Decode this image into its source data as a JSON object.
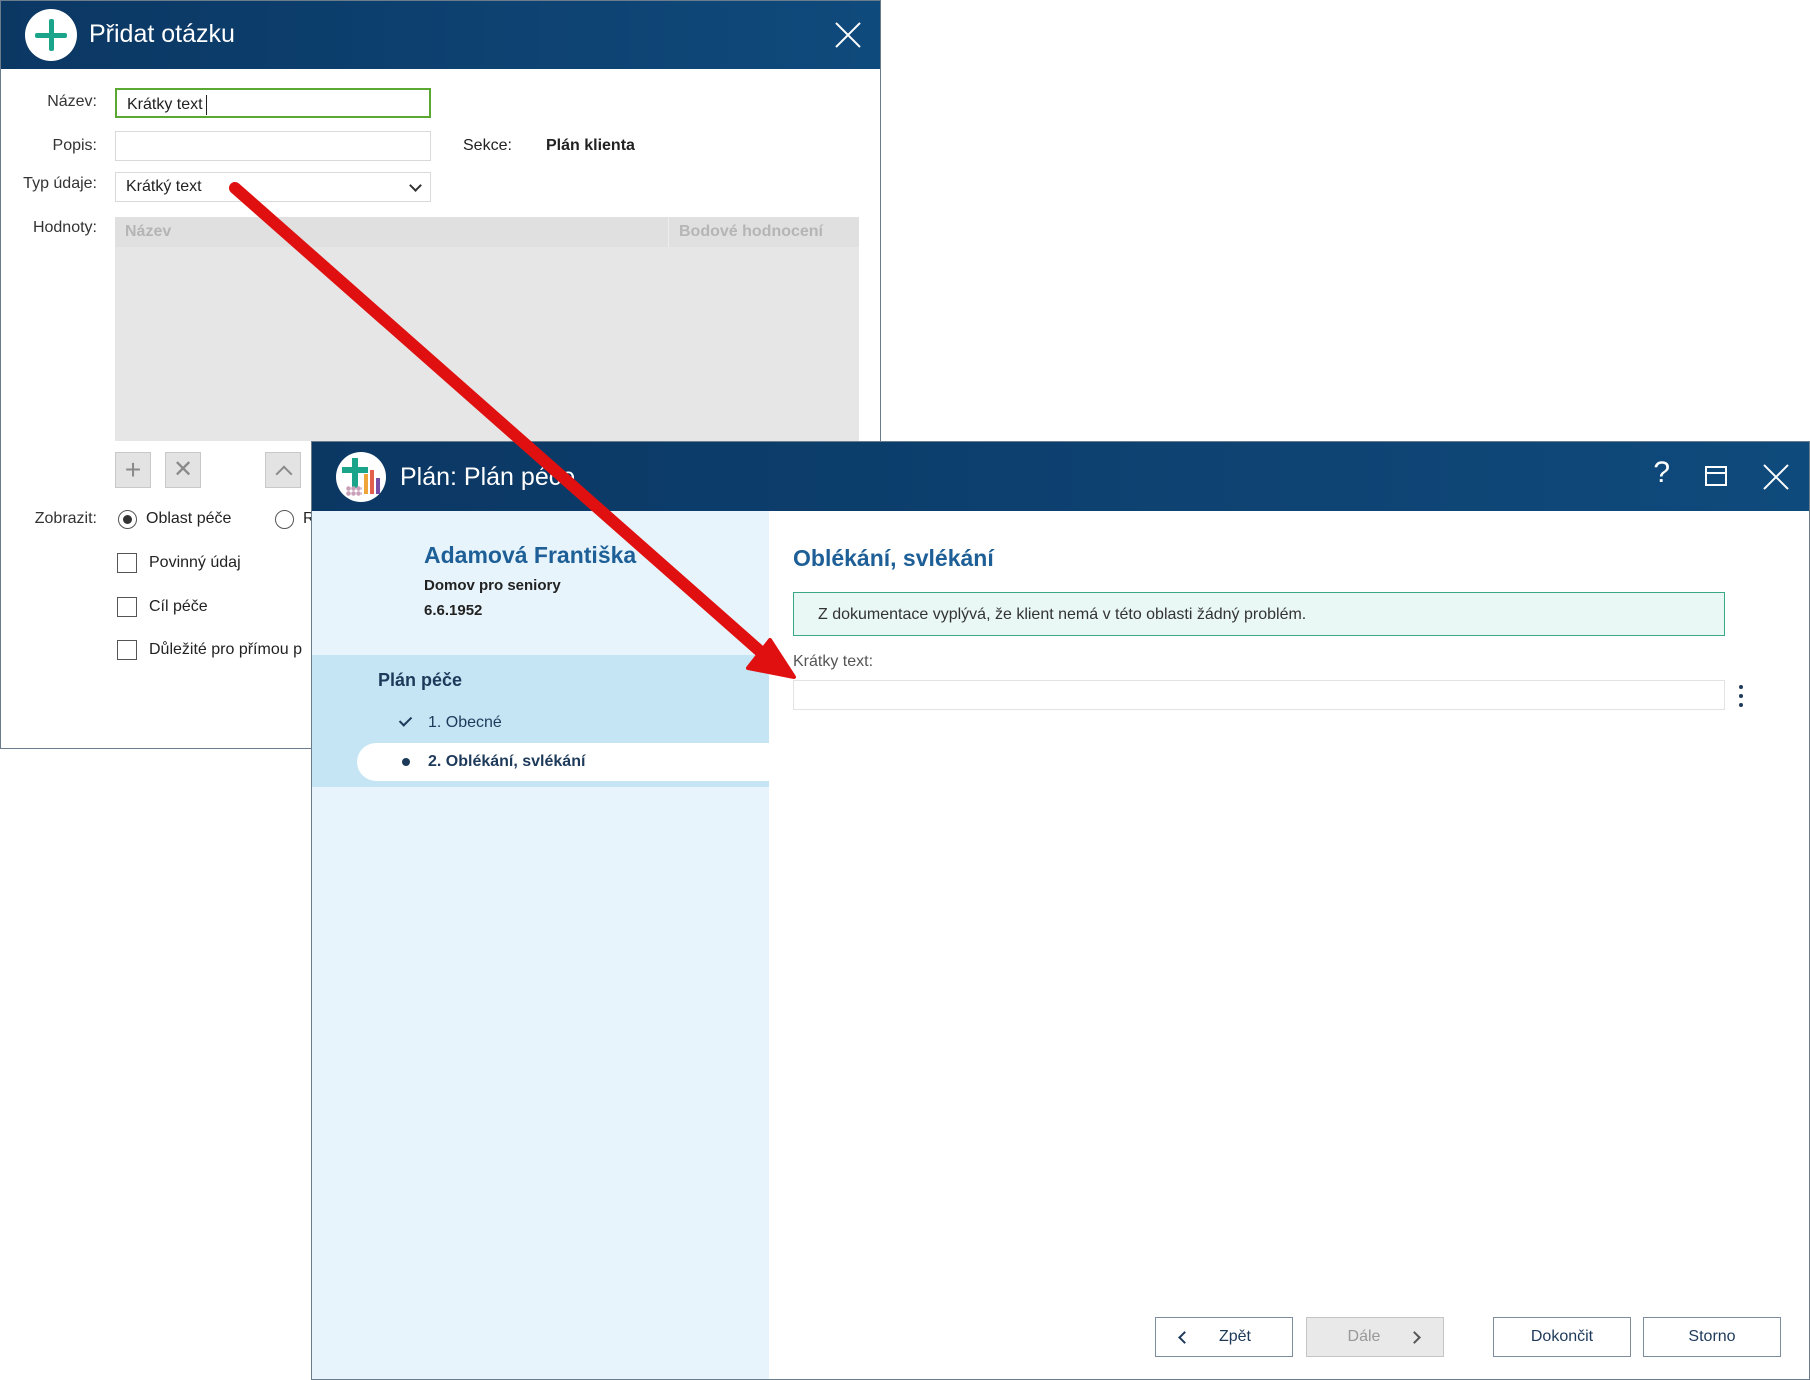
{
  "dialog_add_question": {
    "title": "Přidat otázku",
    "name_label": "Název:",
    "name_value": "Krátky text",
    "description_label": "Popis:",
    "description_value": "",
    "section_label": "Sekce:",
    "section_value": "Plán klienta",
    "datatype_label": "Typ údaje:",
    "datatype_value": "Krátký text",
    "values_label": "Hodnoty:",
    "grid_columns": [
      "Název",
      "Bodové hodnocení"
    ],
    "display_label": "Zobrazit:",
    "display_options": [
      "Oblast péče",
      "R"
    ],
    "checkboxes": [
      "Povinný údaj",
      "Cíl péče",
      "Důležité pro přímou p"
    ]
  },
  "dialog_plan": {
    "title": "Plán: Plán péče",
    "client": {
      "name": "Adamová Františka",
      "facility": "Domov pro seniory",
      "birth_date": "6.6.1952"
    },
    "nav": {
      "title": "Plán péče",
      "items": [
        {
          "label": "1. Obecné",
          "state": "done"
        },
        {
          "label": "2. Oblékání, svlékání",
          "state": "active"
        }
      ]
    },
    "section_title": "Oblékání, svlékání",
    "info_text": "Z dokumentace vyplývá, že klient nemá v této oblasti žádný problém.",
    "question_label": "Krátky text:",
    "question_value": "",
    "buttons": {
      "back": "Zpět",
      "next": "Dále",
      "finish": "Dokončit",
      "cancel": "Storno"
    }
  },
  "colors": {
    "titlebar": "#0b3763",
    "accent_blue": "#1d5f96",
    "teal": "#1aa58a",
    "arrow_red": "#e01010",
    "active_input_border": "#5aa832",
    "info_border": "#3aa884"
  },
  "icons": [
    "plus-circle-icon",
    "close-icon",
    "chevron-down-icon",
    "add-icon",
    "delete-icon",
    "chevron-up-icon",
    "app-logo-icon",
    "help-icon",
    "maximize-icon",
    "check-icon",
    "bullet-icon",
    "kebab-menu-icon",
    "chevron-left-icon",
    "chevron-right-icon",
    "red-arrow"
  ]
}
